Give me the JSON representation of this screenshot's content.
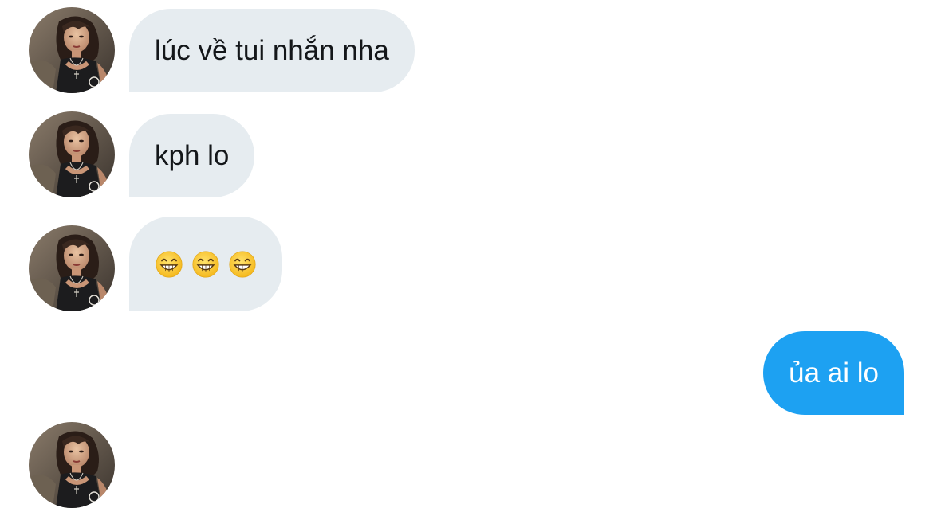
{
  "conversation": {
    "messages": [
      {
        "direction": "incoming",
        "text": "lúc về tui nhắn nha"
      },
      {
        "direction": "incoming",
        "text": "kph lo"
      },
      {
        "direction": "incoming",
        "emojis": [
          "grinning-face-with-smiling-eyes-icon",
          "grinning-face-with-smiling-eyes-icon",
          "grinning-face-with-smiling-eyes-icon"
        ]
      },
      {
        "direction": "outgoing",
        "text": "ủa ai lo"
      }
    ]
  },
  "colors": {
    "incoming_bubble": "#e6ecf0",
    "outgoing_bubble": "#1da1f2",
    "incoming_text": "#14171a",
    "outgoing_text": "#ffffff"
  }
}
